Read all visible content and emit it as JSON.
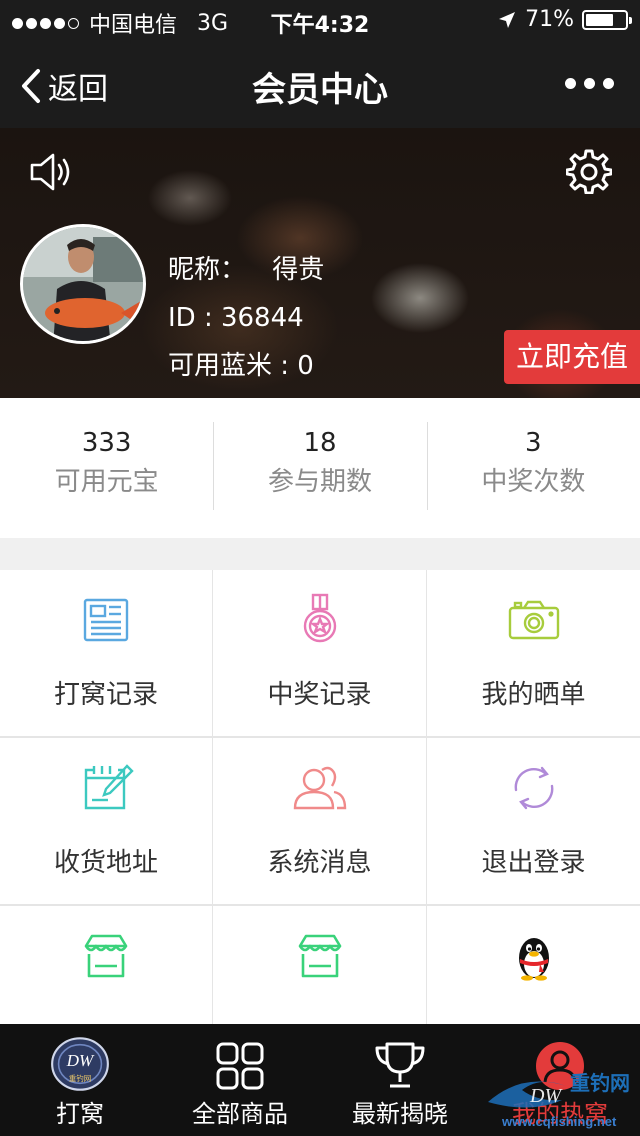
{
  "status_bar": {
    "carrier": "中国电信",
    "network": "3G",
    "time": "下午4:32",
    "battery": "71%",
    "battery_level": 0.71,
    "signal_bars_filled": 4,
    "signal_bars_total": 5
  },
  "nav": {
    "back_label": "返回",
    "title": "会员中心"
  },
  "profile": {
    "nickname_label": "昵称：",
    "nickname": "得贵",
    "id_text": "ID : 36844",
    "balance_text": "可用蓝米 : 0",
    "recharge_button": "立即充值"
  },
  "stats": [
    {
      "value": "333",
      "label": "可用元宝"
    },
    {
      "value": "18",
      "label": "参与期数"
    },
    {
      "value": "3",
      "label": "中奖次数"
    }
  ],
  "menu": [
    {
      "label": "打窝记录",
      "icon": "record-list-icon",
      "color": "#5aa8e0"
    },
    {
      "label": "中奖记录",
      "icon": "medal-icon",
      "color": "#e879b5"
    },
    {
      "label": "我的晒单",
      "icon": "camera-icon",
      "color": "#a7cc3c"
    },
    {
      "label": "收货地址",
      "icon": "calendar-edit-icon",
      "color": "#3cc9c0"
    },
    {
      "label": "系统消息",
      "icon": "users-icon",
      "color": "#f08a8a"
    },
    {
      "label": "退出登录",
      "icon": "refresh-icon",
      "color": "#b08ad8"
    },
    {
      "label": "",
      "icon": "store-icon",
      "color": "#39d27a"
    },
    {
      "label": "",
      "icon": "store-icon",
      "color": "#39d27a"
    },
    {
      "label": "",
      "icon": "qq-penguin-icon",
      "color": "#222222"
    }
  ],
  "tabs": [
    {
      "label": "打窝",
      "icon": "dw-logo-icon"
    },
    {
      "label": "全部商品",
      "icon": "grid-icon"
    },
    {
      "label": "最新揭晓",
      "icon": "trophy-icon"
    },
    {
      "label": "我的热窝",
      "icon": "user-circle-icon",
      "active": true
    }
  ],
  "watermark": {
    "brand": "重钓网",
    "url": "www.cqfishing.net"
  },
  "colors": {
    "accent_red": "#e33b3b",
    "nav_bg": "#1c1c1c",
    "tab_bg": "#111111"
  }
}
